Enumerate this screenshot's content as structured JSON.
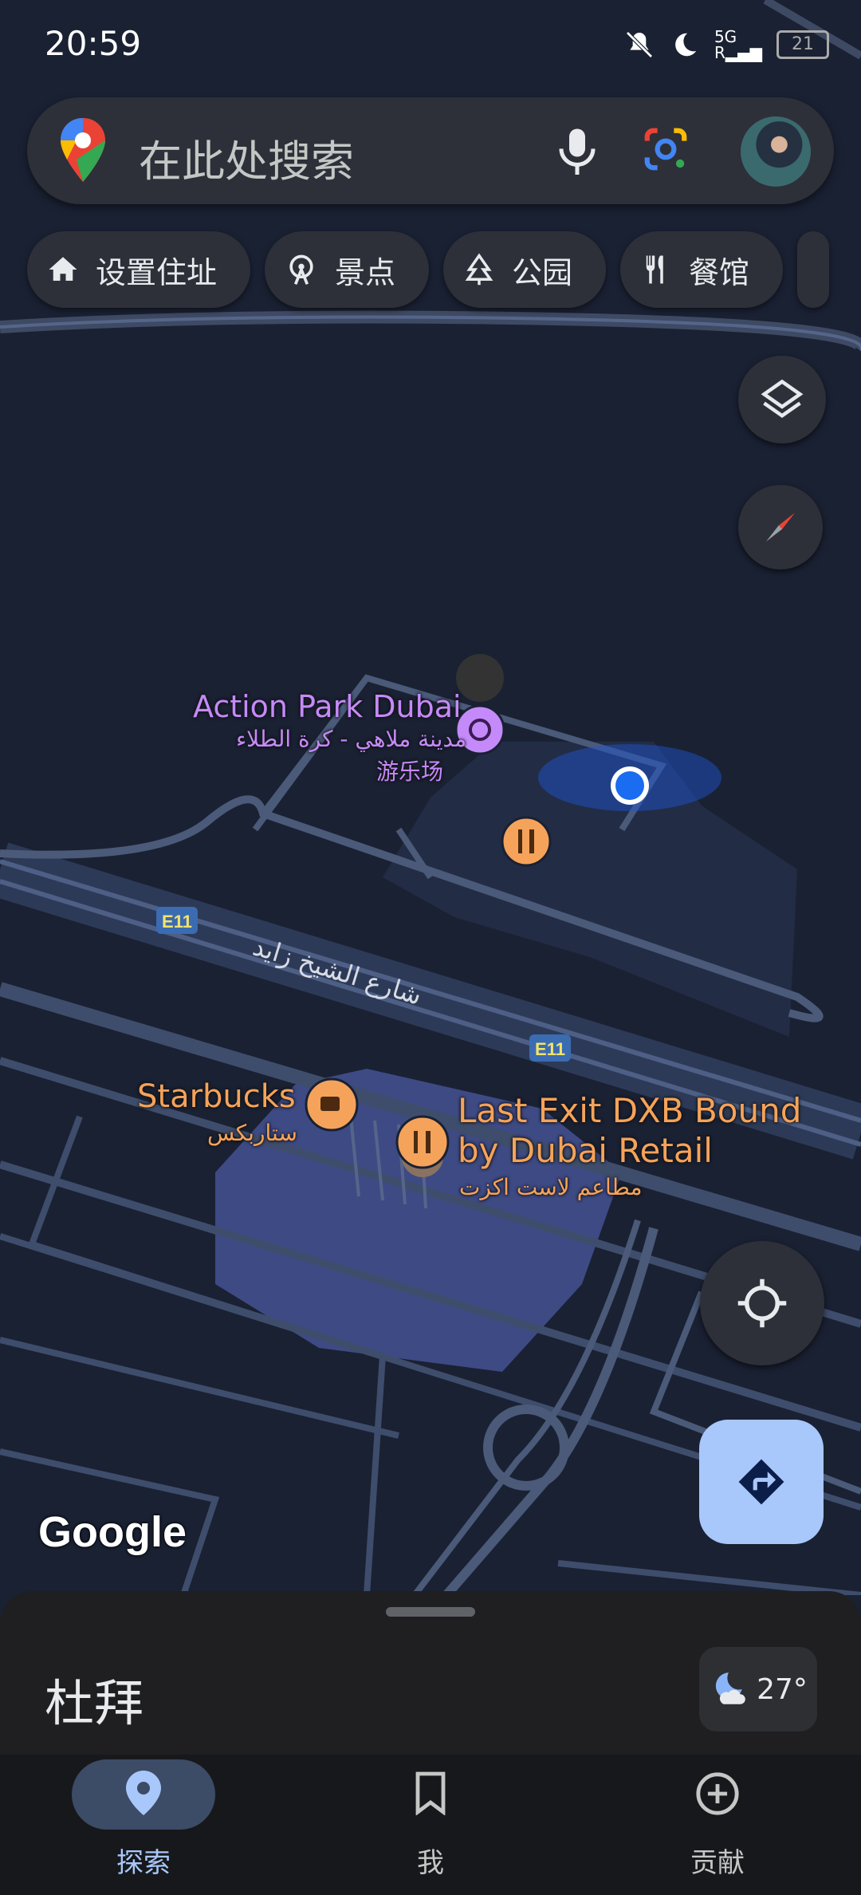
{
  "status_bar": {
    "time": "20:59",
    "network": "5G",
    "battery": "21"
  },
  "search": {
    "placeholder": "在此处搜索"
  },
  "chips": [
    {
      "label": "设置住址",
      "icon": "home-icon"
    },
    {
      "label": "景点",
      "icon": "ferris-wheel-icon"
    },
    {
      "label": "公园",
      "icon": "tree-icon"
    },
    {
      "label": "餐馆",
      "icon": "restaurant-icon"
    }
  ],
  "map": {
    "pois": [
      {
        "name": "Action Park Dubai",
        "name_ar": "مدينة ملاهي - كرة الطلاء",
        "category": "游乐场",
        "icon": "ferris-wheel-icon",
        "color": "#c58af9"
      },
      {
        "name": "Starbucks",
        "name_ar": "ستاربكس",
        "icon": "coffee-icon",
        "color": "#f5a35a"
      },
      {
        "name": "Last Exit DXB Bound",
        "name_line2": "by Dubai Retail",
        "name_ar": "مطاعم لاست اكزت",
        "icon": "restaurant-icon",
        "color": "#f5a35a"
      }
    ],
    "road_name_ar": "شارع الشيخ زايد",
    "road_shield": "E11",
    "attribution": "Google"
  },
  "sheet": {
    "place": "杜拜",
    "temperature": "27°",
    "weather_icon": "night-cloudy-icon"
  },
  "nav": [
    {
      "label": "探索",
      "icon": "location-pin-icon",
      "active": true
    },
    {
      "label": "我",
      "icon": "bookmark-icon",
      "active": false
    },
    {
      "label": "贡献",
      "icon": "add-circle-icon",
      "active": false
    }
  ],
  "colors": {
    "accent": "#a8c7fa",
    "map_bg": "#1a2133",
    "road": "#4a5a78"
  }
}
